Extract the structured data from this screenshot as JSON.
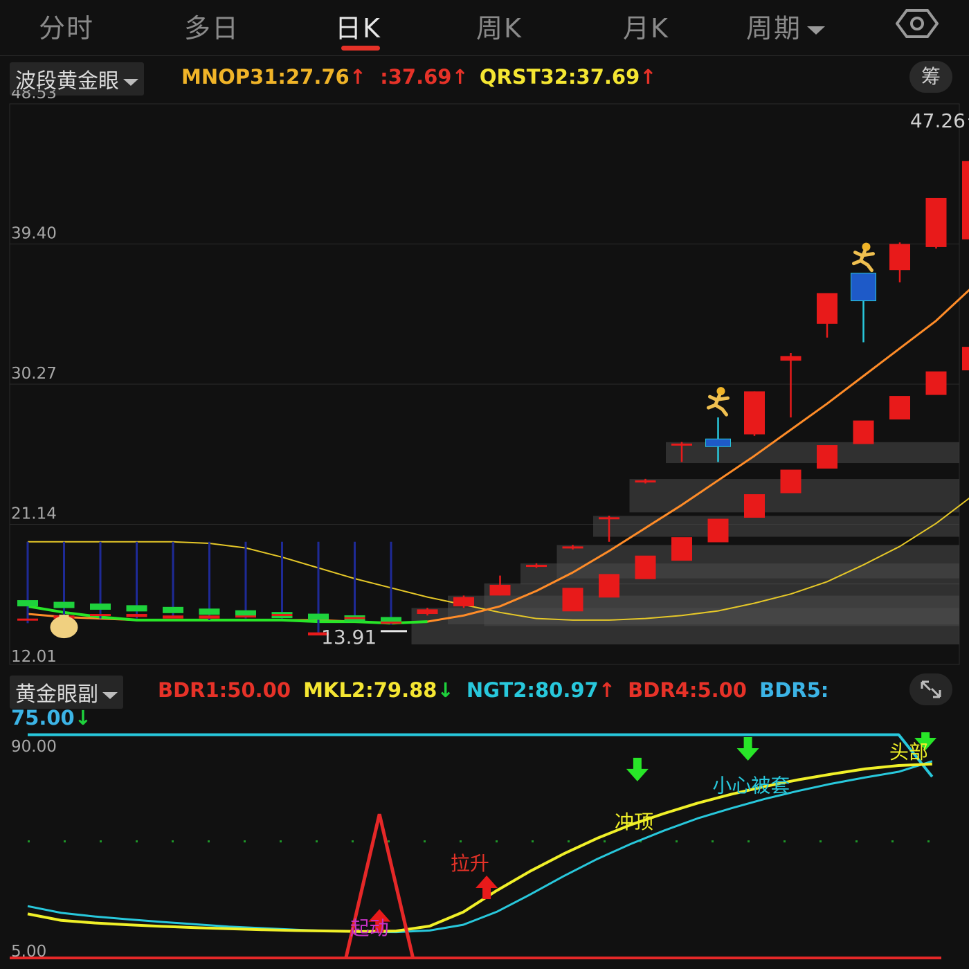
{
  "tabs": [
    "分时",
    "多日",
    "日K",
    "周K",
    "月K",
    "周期"
  ],
  "active_tab": "日K",
  "settings_icon": "hexagon-settings-icon",
  "main_indicator": {
    "name": "波段黄金眼",
    "items": [
      {
        "label": "MNOP31:27.76",
        "arrow": "↑",
        "color": "#f0b428"
      },
      {
        "label": ":37.69",
        "arrow": "↑",
        "color": "#e63228"
      },
      {
        "label": "QRST32:37.69",
        "arrow": "↑",
        "color": "#f5e632"
      }
    ],
    "chip_button": "筹"
  },
  "sub_indicator": {
    "name": "黄金眼副",
    "items": [
      {
        "label": "BDR1:50.00",
        "arrow": "",
        "color": "#e63228"
      },
      {
        "label": "MKL2:79.88",
        "arrow": "↓",
        "color": "#f5e632"
      },
      {
        "label": "NGT2:80.97",
        "arrow": "↑",
        "color": "#28c8dc"
      },
      {
        "label": "BDR4:5.00",
        "arrow": "",
        "color": "#e63228"
      },
      {
        "label": "BDR5:",
        "arrow": "",
        "color": "#3cb4e6"
      }
    ],
    "bdr5_value": "75.00",
    "bdr5_arrow": "↓"
  },
  "colors": {
    "up": "#e81a1a",
    "down": "#1ed23c",
    "orange_line": "#ff8c28",
    "yellow_line": "#e6c828",
    "green_line": "#28e628",
    "cyan_line": "#28c8dc",
    "sub_yellow": "#f0f028",
    "sub_red": "#e62828",
    "sub_dots": "#1e9628"
  },
  "chart_data": [
    {
      "type": "candlestick",
      "ylim": [
        12.01,
        48.53
      ],
      "y_ticks": [
        "48.53",
        "39.40",
        "30.27",
        "21.14",
        "12.01"
      ],
      "high_label": "47.26",
      "low_label": "13.91",
      "candles": [
        {
          "o": 15.0,
          "c": 15.0,
          "h": 15.3,
          "l": 14.7
        },
        {
          "o": 15.2,
          "c": 15.0,
          "h": 15.3,
          "l": 14.9
        },
        {
          "o": 15.2,
          "c": 15.3,
          "h": 15.4,
          "l": 15.0
        },
        {
          "o": 15.1,
          "c": 15.3,
          "h": 15.4,
          "l": 15.0
        },
        {
          "o": 15.0,
          "c": 15.2,
          "h": 15.3,
          "l": 15.0
        },
        {
          "o": 15.0,
          "c": 15.2,
          "h": 15.3,
          "l": 14.9
        },
        {
          "o": 15.1,
          "c": 15.2,
          "h": 15.3,
          "l": 15.0
        },
        {
          "o": 15.2,
          "c": 15.3,
          "h": 15.4,
          "l": 15.0
        },
        {
          "o": 13.9,
          "c": 14.1,
          "h": 14.2,
          "l": 13.91
        },
        {
          "o": 15.0,
          "c": 15.1,
          "h": 15.2,
          "l": 14.9
        },
        {
          "o": 14.7,
          "c": 14.8,
          "h": 15.0,
          "l": 14.6
        },
        {
          "o": 15.3,
          "c": 15.6,
          "h": 15.7,
          "l": 15.2
        },
        {
          "o": 15.8,
          "c": 16.4,
          "h": 16.5,
          "l": 15.7
        },
        {
          "o": 16.5,
          "c": 17.2,
          "h": 17.8,
          "l": 16.5
        },
        {
          "o": 18.4,
          "c": 18.5,
          "h": 18.6,
          "l": 18.3
        },
        {
          "o": 19.6,
          "c": 19.7,
          "h": 19.8,
          "l": 19.5
        },
        {
          "o": 21.5,
          "c": 21.6,
          "h": 21.7,
          "l": 20.0
        },
        {
          "o": 23.9,
          "c": 24.0,
          "h": 24.1,
          "l": 23.8
        },
        {
          "o": 26.3,
          "c": 26.4,
          "h": 26.5,
          "l": 25.2
        },
        {
          "o": 26.2,
          "c": 26.7,
          "h": 28.1,
          "l": 25.2
        },
        {
          "o": 27.0,
          "c": 29.8,
          "h": 29.8,
          "l": 26.9
        },
        {
          "o": 31.8,
          "c": 32.1,
          "h": 32.3,
          "l": 28.1
        },
        {
          "o": 34.2,
          "c": 36.2,
          "h": 36.2,
          "l": 33.3
        },
        {
          "o": 35.7,
          "c": 37.5,
          "h": 37.5,
          "l": 33.0
        },
        {
          "o": 37.7,
          "c": 39.4,
          "h": 39.5,
          "l": 36.9
        },
        {
          "o": 39.2,
          "c": 42.4,
          "h": 42.4,
          "l": 39.1
        },
        {
          "o": 39.7,
          "c": 44.8,
          "h": 47.26,
          "l": 38.9
        },
        {
          "o": 37.1,
          "c": 37.1,
          "h": 37.8,
          "l": 37.0
        }
      ],
      "orange_line": [
        15.3,
        15.1,
        15.0,
        14.9,
        14.9,
        14.9,
        14.9,
        14.9,
        14.9,
        14.8,
        14.7,
        14.8,
        15.2,
        15.8,
        16.8,
        18.0,
        19.4,
        20.9,
        22.4,
        24.0,
        25.6,
        27.3,
        29.0,
        30.8,
        32.6,
        34.4,
        36.6,
        37.6
      ],
      "yellow_line": [
        20.0,
        20.0,
        20.0,
        20.0,
        20.0,
        19.9,
        19.6,
        19.0,
        18.3,
        17.6,
        17.0,
        16.4,
        15.9,
        15.4,
        15.0,
        14.9,
        14.9,
        15.0,
        15.2,
        15.5,
        16.0,
        16.6,
        17.4,
        18.5,
        19.7,
        21.2,
        23.0,
        24.9
      ],
      "green_line": [
        15.8,
        15.4,
        15.1,
        14.9,
        14.9,
        14.9,
        14.9,
        14.9,
        14.8,
        14.8,
        14.7,
        14.8
      ]
    },
    {
      "type": "line",
      "ylim": [
        5.0,
        90.0
      ],
      "y_ticks": [
        "90.00",
        "5.00"
      ],
      "series": [
        {
          "name": "BDR1",
          "values": [
            50,
            50,
            50,
            50,
            50,
            50,
            50,
            50,
            50,
            50,
            50,
            50,
            50,
            50,
            50,
            50,
            50,
            50,
            50,
            50,
            50,
            50,
            50,
            50,
            50,
            50,
            50,
            50
          ]
        },
        {
          "name": "MKL2",
          "values": [
            22,
            19.5,
            18.5,
            17.8,
            17.2,
            16.7,
            16.3,
            15.9,
            15.6,
            15.4,
            15.2,
            15.4,
            17.3,
            22.7,
            31.0,
            38.5,
            45.2,
            51.2,
            56.4,
            60.8,
            64.8,
            68.2,
            71.2,
            73.8,
            76.0,
            78.0,
            79.3,
            79.88
          ]
        },
        {
          "name": "NGT2",
          "values": [
            25.0,
            22.4,
            21.0,
            19.9,
            18.9,
            18.0,
            17.1,
            16.5,
            15.9,
            15.4,
            15.1,
            15.0,
            15.6,
            17.8,
            22.8,
            29.5,
            36.6,
            43.2,
            49.0,
            54.2,
            58.9,
            62.8,
            66.4,
            69.5,
            72.3,
            74.7,
            76.9,
            80.97
          ]
        },
        {
          "name": "BDR5",
          "values": [
            94,
            94,
            94,
            94,
            94,
            94,
            94,
            94,
            94,
            94,
            94,
            94,
            94,
            94,
            94,
            94,
            94,
            94,
            94,
            94,
            94,
            94,
            94,
            94,
            94,
            94,
            94,
            75
          ]
        }
      ],
      "spike": {
        "start_index": 9.5,
        "peak_index": 10.5,
        "end_index": 11.5,
        "peak": 60.5,
        "base": 5.0
      },
      "annotations": [
        "起动",
        "拉升",
        "冲顶",
        "小心被套",
        "头部"
      ]
    }
  ]
}
